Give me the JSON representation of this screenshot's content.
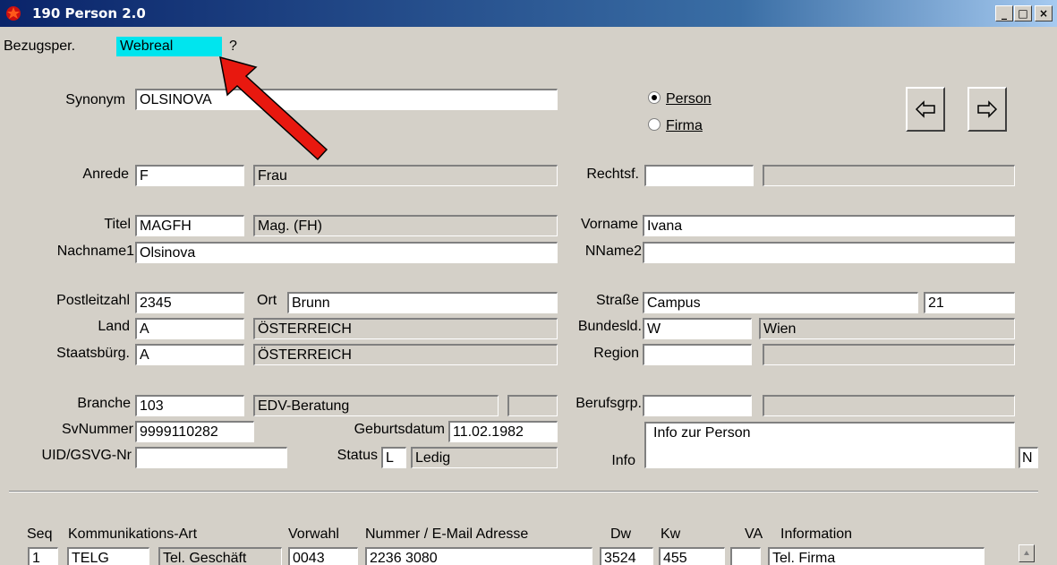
{
  "window": {
    "title": "190 Person 2.0",
    "buttons": [
      "_",
      "□",
      "×"
    ]
  },
  "menu": [
    {
      "label": "Bezugsper."
    },
    {
      "label": "Webreal",
      "highlight_color": "#00e5ee"
    },
    {
      "label": "?"
    }
  ],
  "form": {
    "synonym": {
      "label": "Synonym",
      "value": "OLSINOVA"
    },
    "radio_person": {
      "label": "Person",
      "checked": true
    },
    "radio_firma": {
      "label": "Firma",
      "checked": false
    },
    "nav": {
      "prev_icon": "arrow-left-icon",
      "next_icon": "arrow-right-icon"
    },
    "anrede": {
      "label": "Anrede",
      "code": "F",
      "text": "Frau"
    },
    "rechtsf": {
      "label": "Rechtsf.",
      "code": "",
      "text": ""
    },
    "titel": {
      "label": "Titel",
      "code": "MAGFH",
      "text": "Mag. (FH)"
    },
    "vorname": {
      "label": "Vorname",
      "value": "Ivana"
    },
    "nachname1": {
      "label": "Nachname1",
      "value": "Olsinova"
    },
    "nname2": {
      "label": "NName2",
      "value": ""
    },
    "plz": {
      "label": "Postleitzahl",
      "value": "2345"
    },
    "ort": {
      "label": "Ort",
      "value": "Brunn"
    },
    "strasse": {
      "label": "Straße",
      "value": "Campus",
      "number": "21"
    },
    "land": {
      "label": "Land",
      "code": "A",
      "text": "ÖSTERREICH"
    },
    "bundesld": {
      "label": "Bundesld.",
      "code": "W",
      "text": "Wien"
    },
    "staatsbuerg": {
      "label": "Staatsbürg.",
      "code": "A",
      "text": "ÖSTERREICH"
    },
    "region": {
      "label": "Region",
      "code": "",
      "text": ""
    },
    "branche": {
      "label": "Branche",
      "code": "103",
      "text": "EDV-Beratung",
      "extra": ""
    },
    "berufsgrp": {
      "label": "Berufsgrp.",
      "code": "",
      "text": ""
    },
    "svnummer": {
      "label": "SvNummer",
      "value": "9999110282"
    },
    "geburtsdatum": {
      "label": "Geburtsdatum",
      "value": "11.02.1982"
    },
    "uid": {
      "label": "UID/GSVG-Nr",
      "value": ""
    },
    "status": {
      "label": "Status",
      "code": "L",
      "text": "Ledig"
    },
    "info": {
      "label": "Info",
      "value": "Info zur Person",
      "flag": "N"
    }
  },
  "komm": {
    "headers": {
      "seq": "Seq",
      "art": "Kommunikations-Art",
      "vorwahl": "Vorwahl",
      "nummer": "Nummer / E-Mail Adresse",
      "dw": "Dw",
      "kw": "Kw",
      "va": "VA",
      "information": "Information"
    },
    "rows": [
      {
        "seq": "1",
        "code": "TELG",
        "art": "Tel. Geschäft",
        "vorwahl": "0043",
        "nummer": "2236 3080",
        "dw": "3524",
        "kw": "455",
        "va": "",
        "information": "Tel. Firma"
      }
    ]
  },
  "annotation": {
    "color": "#ff0000"
  }
}
